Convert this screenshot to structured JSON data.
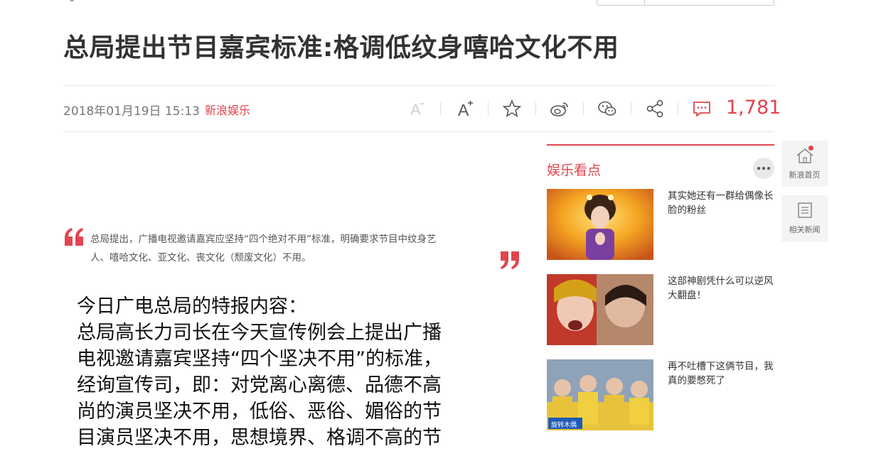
{
  "article": {
    "headline": "总局提出节目嘉宾标准:格调低纹身嘻哈文化不用",
    "date": "2018年01月19日 15:13",
    "source": "新浪娱乐",
    "comment_count": "1,781",
    "quote_line1": "总局提出，广播电视邀请嘉宾应坚持“四个绝对不用”标准，明确要求节目中纹身艺",
    "quote_line2": "人、嘻哈文化、亚文化、丧文化（颓废文化）不用。",
    "image_text": [
      "今日广电总局的特报内容：",
      "总局高长力司长在今天宣传例会上提出广播",
      "电视邀请嘉宾坚持“四个坚决不用”的标准，",
      "经询宣传司，即：对党离心离德、品德不高",
      "尚的演员坚决不用，低俗、恶俗、媚俗的节",
      "目演员坚决不用，思想境界、格调不高的节"
    ]
  },
  "toolbar": {
    "icons": [
      "font-decrease-icon",
      "font-increase-icon",
      "star-icon",
      "weibo-icon",
      "wechat-icon",
      "share-icon",
      "comment-icon"
    ]
  },
  "sidebar": {
    "title": "娱乐看点",
    "items": [
      {
        "text": "其实她还有一群给偶像长脸的粉丝"
      },
      {
        "text": "这部神剧凭什么可以逆风大翻盘！"
      },
      {
        "text": "再不吐槽下这俩节目，我真的要憋死了",
        "thumb_caption": "旋转木偶"
      }
    ]
  },
  "float_nav": {
    "home_label": "新浪首页",
    "related_label": "相关新闻"
  },
  "colors": {
    "accent": "#e2444e",
    "text": "#333333",
    "meta": "#777777"
  }
}
